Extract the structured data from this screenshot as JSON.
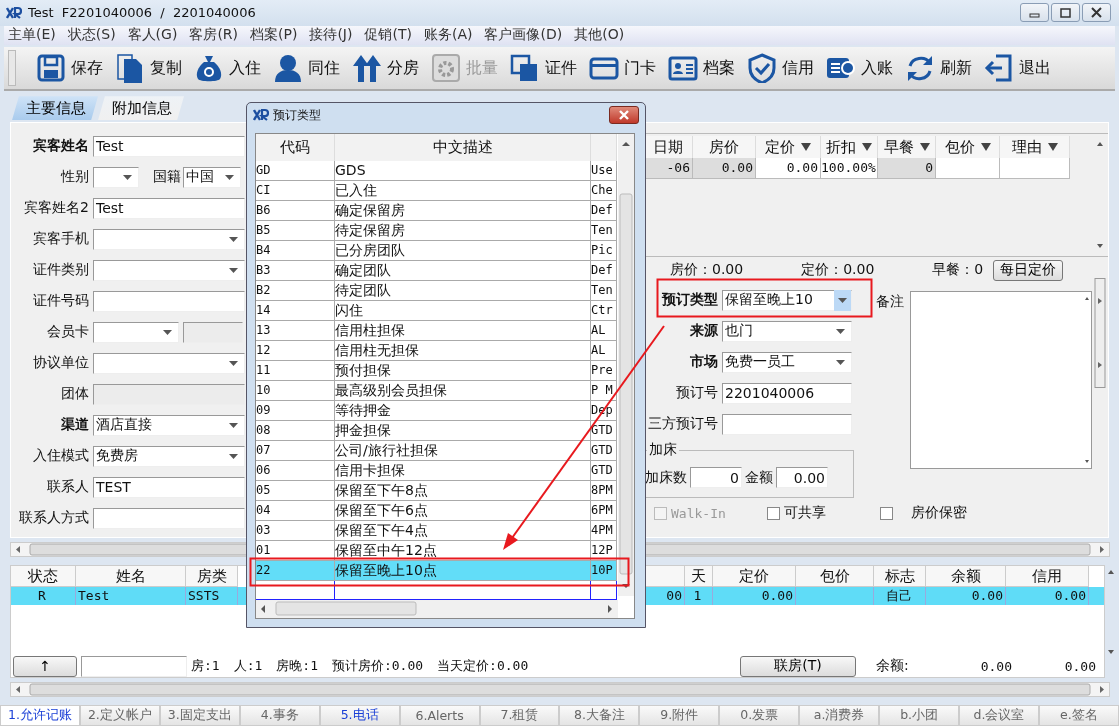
{
  "window": {
    "title": "Test  F2201040006  /  2201040006"
  },
  "menu": [
    "主单(E)",
    "状态(S)",
    "客人(G)",
    "客房(R)",
    "档案(P)",
    "接待(J)",
    "促销(T)",
    "账务(A)",
    "客户画像(D)",
    "其他(O)"
  ],
  "toolbar": [
    {
      "label": "保存",
      "disabled": false
    },
    {
      "label": "复制",
      "disabled": false
    },
    {
      "label": "入住",
      "disabled": false
    },
    {
      "label": "同住",
      "disabled": false
    },
    {
      "label": "分房",
      "disabled": false
    },
    {
      "label": "批量",
      "disabled": true
    },
    {
      "label": "证件",
      "disabled": false
    },
    {
      "label": "门卡",
      "disabled": false
    },
    {
      "label": "档案",
      "disabled": false
    },
    {
      "label": "信用",
      "disabled": false
    },
    {
      "label": "入账",
      "disabled": false
    },
    {
      "label": "刷新",
      "disabled": false
    },
    {
      "label": "退出",
      "disabled": false
    }
  ],
  "tabs": [
    {
      "label": "主要信息",
      "selected": true
    },
    {
      "label": "附加信息",
      "selected": false
    }
  ],
  "guest_form": [
    {
      "kind": "text",
      "label": "宾客姓名",
      "required": true,
      "value": "Test"
    },
    {
      "kind": "pair",
      "label": "性别",
      "required": false,
      "label2": "国籍",
      "value2": "中国"
    },
    {
      "kind": "text",
      "label": "宾客姓名2",
      "required": false,
      "value": "Test"
    },
    {
      "kind": "select",
      "label": "宾客手机",
      "required": false
    },
    {
      "kind": "select",
      "label": "证件类别",
      "required": false
    },
    {
      "kind": "text",
      "label": "证件号码",
      "required": false
    },
    {
      "kind": "select_extra",
      "label": "会员卡",
      "required": false
    },
    {
      "kind": "select",
      "label": "协议单位",
      "required": false
    },
    {
      "kind": "readonly",
      "label": "团体",
      "required": false
    },
    {
      "kind": "select",
      "label": "渠道",
      "required": true,
      "value": "酒店直接"
    },
    {
      "kind": "select",
      "label": "入住模式",
      "required": false,
      "value": "免费房"
    },
    {
      "kind": "text",
      "label": "联系人",
      "required": false,
      "value": "TEST"
    },
    {
      "kind": "text",
      "label": "联系人方式",
      "required": false
    }
  ],
  "rate_grid": {
    "columns": [
      {
        "label": "日期",
        "filter": false,
        "editable": false
      },
      {
        "label": "房价",
        "filter": false,
        "editable": false
      },
      {
        "label": "定价",
        "filter": true,
        "editable": true
      },
      {
        "label": "折扣",
        "filter": true,
        "editable": true
      },
      {
        "label": "早餐",
        "filter": true,
        "editable": false
      },
      {
        "label": "包价",
        "filter": true,
        "editable": true
      },
      {
        "label": "理由",
        "filter": true,
        "editable": true
      }
    ],
    "rows": [
      {
        "cells": [
          "-06",
          "0.00",
          "0.00",
          "100.00%",
          "0"
        ]
      }
    ]
  },
  "rate_summary": [
    "房价：0.00",
    "定价：0.00",
    "早餐：0"
  ],
  "daily_rate_button": "每日定价",
  "booking_form": [
    {
      "kind": "select",
      "label": "预订类型",
      "required": true,
      "value": "保留至晚上10",
      "focused": true
    },
    {
      "kind": "select",
      "label": "来源",
      "required": true,
      "value": "也门",
      "focused": false
    },
    {
      "kind": "select",
      "label": "市场",
      "required": true,
      "value": "免费一员工",
      "focused": false
    },
    {
      "kind": "text",
      "label": "预订号",
      "required": false,
      "value": "2201040006"
    },
    {
      "kind": "text",
      "label": "三方预订号",
      "required": false
    }
  ],
  "remarks": {
    "label": "备注"
  },
  "extra_bed": {
    "title": "加床",
    "count_label": "加床数",
    "count": "0",
    "amount_label": "金额",
    "amount": "0.00"
  },
  "options": [
    {
      "label": "Walk-In",
      "checked": false,
      "disabled": true
    },
    {
      "label": "可共享",
      "checked": false,
      "disabled": false
    },
    {
      "label": "房价保密",
      "checked": false,
      "disabled": false
    }
  ],
  "guest_table": {
    "columns": [
      "状态",
      "姓名",
      "房类",
      null,
      "天",
      "定价",
      "包价",
      "标志",
      "余额",
      "信用"
    ],
    "rows": [
      {
        "selected": true,
        "cells": [
          "R",
          "Test",
          "SSTS",
          "00",
          "1",
          "0.00",
          null,
          "自己",
          "0.00",
          "0.00"
        ]
      }
    ]
  },
  "summary": {
    "up_button": "↑",
    "stats": [
      "房:1",
      "人:1",
      "房晚:1",
      "预计房价:0.00",
      "当天定价:0.00"
    ],
    "link_button": "联房(T)",
    "balance_label": "余额:",
    "balances": [
      "0.00",
      "0.00"
    ]
  },
  "bottom_tabs": [
    {
      "label": "1.允许记账",
      "selected": true,
      "has_content": true
    },
    {
      "label": "2.定义帐户",
      "selected": false,
      "has_content": false
    },
    {
      "label": "3.固定支出",
      "selected": false,
      "has_content": false
    },
    {
      "label": "4.事务",
      "selected": false,
      "has_content": false
    },
    {
      "label": "5.电话",
      "selected": false,
      "has_content": true
    },
    {
      "label": "6.Alerts",
      "selected": false,
      "has_content": false
    },
    {
      "label": "7.租赁",
      "selected": false,
      "has_content": false
    },
    {
      "label": "8.大备注",
      "selected": false,
      "has_content": false
    },
    {
      "label": "9.附件",
      "selected": false,
      "has_content": false
    },
    {
      "label": "0.发票",
      "selected": false,
      "has_content": false
    },
    {
      "label": "a.消费券",
      "selected": false,
      "has_content": false
    },
    {
      "label": "b.小团",
      "selected": false,
      "has_content": false
    },
    {
      "label": "d.会议室",
      "selected": false,
      "has_content": false
    },
    {
      "label": "e.签名",
      "selected": false,
      "has_content": false
    }
  ],
  "dialog": {
    "title": "预订类型",
    "columns": [
      "代码",
      "中文描述"
    ],
    "rows": [
      {
        "code": "GD",
        "description": "GDS",
        "column_3": "Use",
        "selected": false
      },
      {
        "code": "CI",
        "description": "已入住",
        "column_3": "Che",
        "selected": false
      },
      {
        "code": "B6",
        "description": "确定保留房",
        "column_3": "Def",
        "selected": false
      },
      {
        "code": "B5",
        "description": "待定保留房",
        "column_3": "Ten",
        "selected": false
      },
      {
        "code": "B4",
        "description": "已分房团队",
        "column_3": "Pic",
        "selected": false
      },
      {
        "code": "B3",
        "description": "确定团队",
        "column_3": "Def",
        "selected": false
      },
      {
        "code": "B2",
        "description": "待定团队",
        "column_3": "Ten",
        "selected": false
      },
      {
        "code": "14",
        "description": "闪住",
        "column_3": "Ctr",
        "selected": false
      },
      {
        "code": "13",
        "description": "信用柱担保",
        "column_3": "AL",
        "selected": false
      },
      {
        "code": "12",
        "description": "信用柱无担保",
        "column_3": "AL",
        "selected": false
      },
      {
        "code": "11",
        "description": "预付担保",
        "column_3": "Pre",
        "selected": false
      },
      {
        "code": "10",
        "description": "最高级别会员担保",
        "column_3": "P M",
        "selected": false
      },
      {
        "code": "09",
        "description": "等待押金",
        "column_3": "Dep",
        "selected": false
      },
      {
        "code": "08",
        "description": "押金担保",
        "column_3": "GTD",
        "selected": false
      },
      {
        "code": "07",
        "description": "公司/旅行社担保",
        "column_3": "GTD",
        "selected": false
      },
      {
        "code": "06",
        "description": "信用卡担保",
        "column_3": "GTD",
        "selected": false
      },
      {
        "code": "05",
        "description": "保留至下午8点",
        "column_3": "8PM",
        "selected": false
      },
      {
        "code": "04",
        "description": "保留至下午6点",
        "column_3": "6PM",
        "selected": false
      },
      {
        "code": "03",
        "description": "保留至下午4点",
        "column_3": "4PM",
        "selected": false
      },
      {
        "code": "01",
        "description": "保留至中午12点",
        "column_3": "12P",
        "selected": false
      },
      {
        "code": "22",
        "description": "保留至晚上10点",
        "column_3": "10P",
        "selected": true
      }
    ]
  }
}
